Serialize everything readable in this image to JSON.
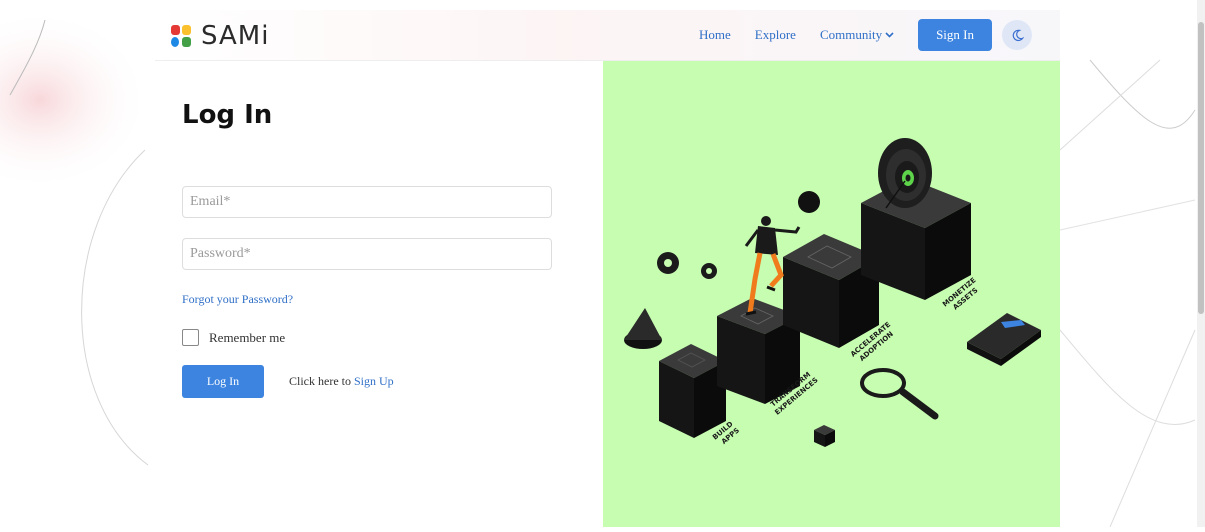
{
  "brand": {
    "name": "SAMi"
  },
  "nav": {
    "home": "Home",
    "explore": "Explore",
    "community": "Community",
    "sign_in": "Sign In"
  },
  "login": {
    "title": "Log In",
    "email_placeholder": "Email*",
    "email_value": "",
    "password_placeholder": "Password*",
    "password_value": "",
    "forgot": "Forgot your Password?",
    "remember": "Remember me",
    "remember_checked": false,
    "submit": "Log In",
    "signup_prefix": "Click here to ",
    "signup_link": "Sign Up"
  },
  "illustration": {
    "steps": [
      {
        "line1": "BUILD",
        "line2": "APPS"
      },
      {
        "line1": "TRANSFORM",
        "line2": "EXPERIENCES"
      },
      {
        "line1": "ACCELERATE",
        "line2": "ADOPTION"
      },
      {
        "line1": "MONETIZE",
        "line2": "ASSETS"
      }
    ]
  },
  "icons": {
    "theme": "moon-icon",
    "community_dropdown": "chevron-down-icon"
  },
  "colors": {
    "accent": "#3c84e0",
    "link": "#2f6fc7",
    "illustration_bg": "#c6fdb0",
    "logo_red": "#e53935",
    "logo_yellow": "#fbc02d",
    "logo_blue": "#1e88e5",
    "logo_green": "#43a047"
  }
}
